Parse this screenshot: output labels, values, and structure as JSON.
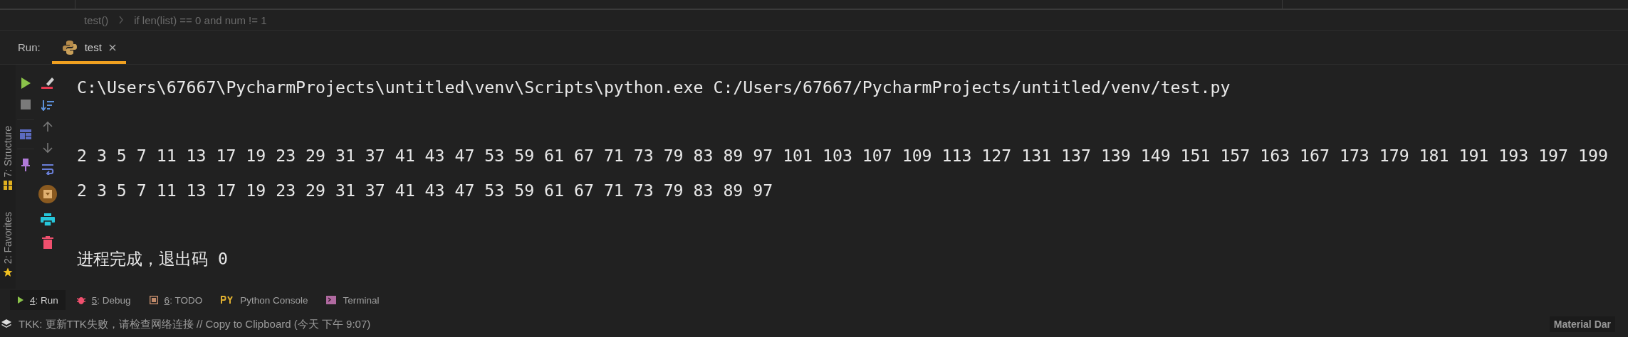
{
  "breadcrumb": [
    "test()",
    "if len(list) == 0 and num != 1"
  ],
  "run_panel": {
    "label": "Run:",
    "tabs": [
      {
        "label": "test",
        "selected": true
      }
    ]
  },
  "side_tabs": [
    {
      "label": "7: Structure",
      "kind": "structure"
    },
    {
      "label": "2: Favorites",
      "kind": "favorites"
    }
  ],
  "console": {
    "lines": [
      {
        "kind": "command",
        "text": "C:\\Users\\67667\\PycharmProjects\\untitled\\venv\\Scripts\\python.exe C:/Users/67667/PycharmProjects/untitled/venv/test.py"
      },
      {
        "kind": "output",
        "text": "2 3 5 7 11 13 17 19 23 29 31 37 41 43 47 53 59 61 67 71 73 79 83 89 97 101 103 107 109 113 127 131 137 139 149 151 157 163 167 173 179 181 191 193 197 199"
      },
      {
        "kind": "output",
        "text": "2 3 5 7 11 13 17 19 23 29 31 37 41 43 47 53 59 61 67 71 73 79 83 89 97"
      },
      {
        "kind": "exit",
        "text": "进程完成，退出码 0"
      }
    ]
  },
  "tool_windows": [
    {
      "kind": "run",
      "key": "4",
      "rest": ": Run",
      "selected": true
    },
    {
      "kind": "debug",
      "key": "5",
      "rest": ": Debug",
      "selected": false
    },
    {
      "kind": "todo",
      "key": "6",
      "rest": ": TODO",
      "selected": false
    },
    {
      "kind": "python",
      "rest": "Python Console",
      "selected": false
    },
    {
      "kind": "terminal",
      "rest": "Terminal",
      "selected": false
    }
  ],
  "status_bar": {
    "message": "TKK: 更新TTK失败，请检查网络连接 // Copy to Clipboard (今天 下午 9:07)",
    "theme": "Material Dar"
  }
}
